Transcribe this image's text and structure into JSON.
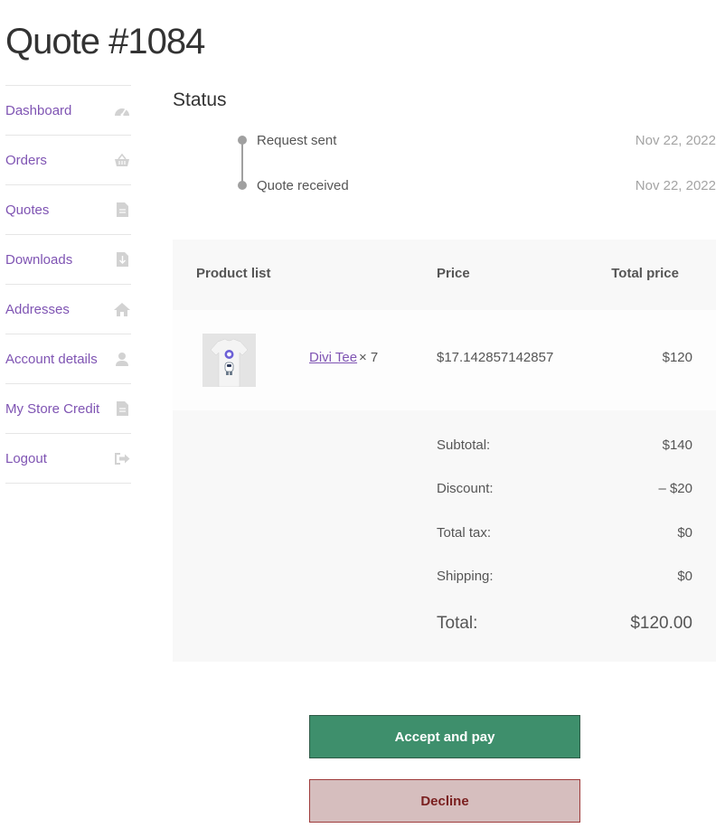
{
  "page": {
    "title": "Quote #1084"
  },
  "sidebar": {
    "items": [
      {
        "label": "Dashboard",
        "icon": "dashboard-icon"
      },
      {
        "label": "Orders",
        "icon": "basket-icon"
      },
      {
        "label": "Quotes",
        "icon": "document-icon"
      },
      {
        "label": "Downloads",
        "icon": "file-download-icon"
      },
      {
        "label": "Addresses",
        "icon": "home-icon"
      },
      {
        "label": "Account details",
        "icon": "user-icon"
      },
      {
        "label": "My Store Credit",
        "icon": "document-icon"
      },
      {
        "label": "Logout",
        "icon": "sign-out-icon"
      }
    ]
  },
  "status": {
    "title": "Status",
    "events": [
      {
        "label": "Request sent",
        "date": "Nov 22, 2022"
      },
      {
        "label": "Quote received",
        "date": "Nov 22, 2022"
      }
    ]
  },
  "table": {
    "headers": {
      "product": "Product list",
      "price": "Price",
      "total": "Total price"
    },
    "rows": [
      {
        "name": "Divi Tee",
        "qty": "× 7",
        "price": "$17.142857142857",
        "total": "$120"
      }
    ],
    "totals": [
      {
        "label": "Subtotal:",
        "value": "$140"
      },
      {
        "label": "Discount:",
        "value": "– $20"
      },
      {
        "label": "Total tax:",
        "value": "$0"
      },
      {
        "label": "Shipping:",
        "value": "$0"
      }
    ],
    "grand": {
      "label": "Total:",
      "value": "$120.00"
    }
  },
  "actions": {
    "accept": "Accept and pay",
    "decline": "Decline"
  },
  "colors": {
    "link": "#7f54b3",
    "accept": "#3e8f6c",
    "decline": "#d6bebe"
  }
}
